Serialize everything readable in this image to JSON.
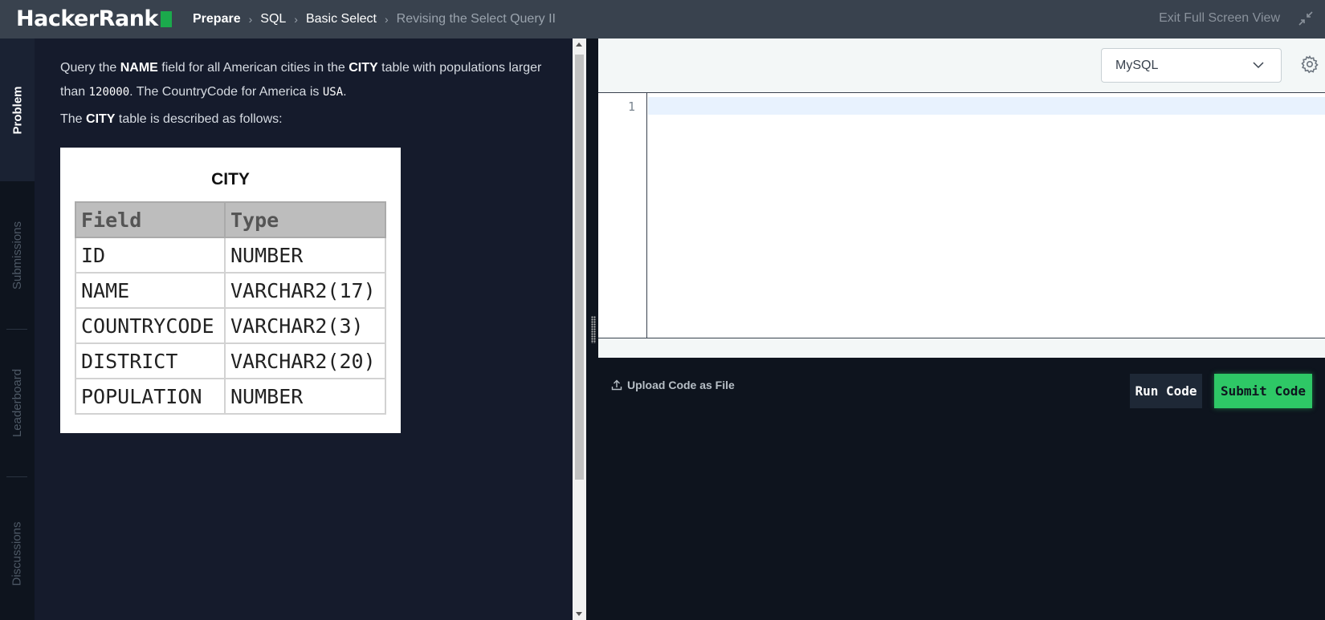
{
  "app": {
    "logo_text": "HackerRank",
    "brand_color": "#1ba94c"
  },
  "breadcrumb": {
    "items": [
      "Prepare",
      "SQL",
      "Basic Select",
      "Revising the Select Query II"
    ]
  },
  "header": {
    "exit_fullscreen_label": "Exit Full Screen View"
  },
  "sidetabs": {
    "items": [
      "Problem",
      "Submissions",
      "Leaderboard",
      "Discussions"
    ],
    "active": "Problem"
  },
  "problem": {
    "p1_a": "Query the ",
    "p1_b": "NAME",
    "p1_c": " field for all American cities in the ",
    "p1_d": "CITY",
    "p1_e": " table with populations larger",
    "p1_f": "than ",
    "p1_g": "120000",
    "p1_h": ". The CountryCode for America is ",
    "p1_i": "USA",
    "p1_j": ".",
    "p2_a": "The ",
    "p2_b": "CITY",
    "p2_c": " table is described as follows:"
  },
  "city_table": {
    "title": "CITY",
    "columns": [
      "Field",
      "Type"
    ],
    "rows": [
      [
        "ID",
        "NUMBER"
      ],
      [
        "NAME",
        "VARCHAR2(17)"
      ],
      [
        "COUNTRYCODE",
        "VARCHAR2(3)"
      ],
      [
        "DISTRICT",
        "VARCHAR2(20)"
      ],
      [
        "POPULATION",
        "NUMBER"
      ]
    ]
  },
  "editor": {
    "language": "MySQL",
    "line_numbers": [
      "1"
    ],
    "code": ""
  },
  "actions": {
    "upload_label": "Upload Code as File",
    "run_label": "Run Code",
    "submit_label": "Submit Code"
  }
}
